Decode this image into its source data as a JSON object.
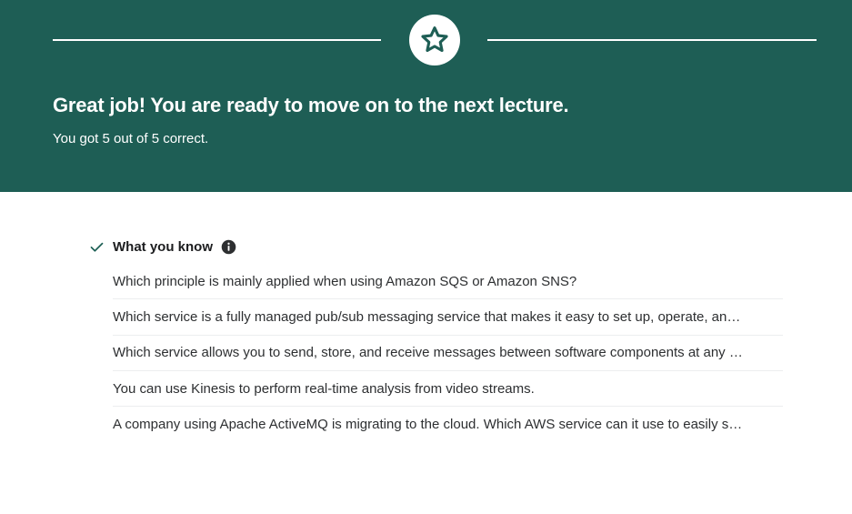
{
  "banner": {
    "icon": "star-icon",
    "headline": "Great job! You are ready to move on to the next lecture.",
    "score_text": "You got 5 out of 5 correct.",
    "background_color": "#1e5e55"
  },
  "section": {
    "check_icon": "check-icon",
    "title": "What you know",
    "info_icon": "info-icon",
    "accent_color": "#1e6055"
  },
  "questions": [
    "Which principle is mainly applied when using Amazon SQS or Amazon SNS?",
    "Which service is a fully managed pub/sub messaging service that makes it easy to set up, operate, an…",
    "Which service allows you to send, store, and receive messages between software components at any …",
    "You can use Kinesis to perform real-time analysis from video streams.",
    "A company using Apache ActiveMQ is migrating to the cloud. Which AWS service can it use to easily s…"
  ]
}
